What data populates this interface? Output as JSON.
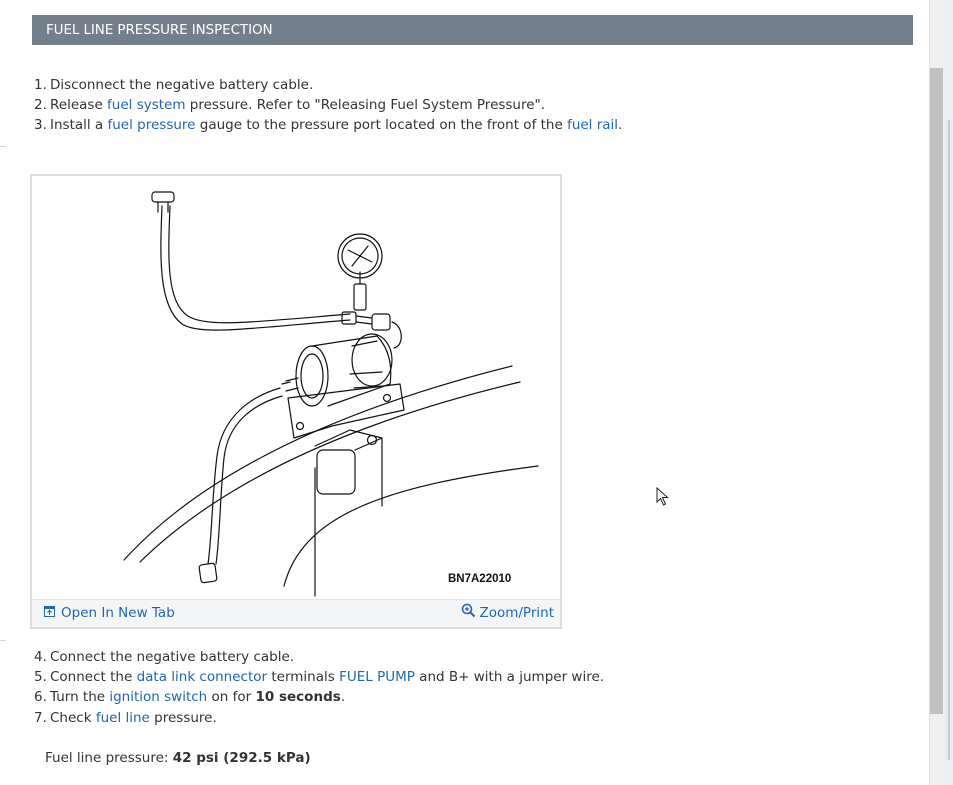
{
  "section_title": "FUEL LINE PRESSURE INSPECTION",
  "steps_a": [
    {
      "num": "1.",
      "parts": [
        {
          "t": "Disconnect the negative battery cable."
        }
      ]
    },
    {
      "num": "2.",
      "parts": [
        {
          "t": "Release "
        },
        {
          "t": "fuel system",
          "link": true
        },
        {
          "t": " pressure. Refer to \"Releasing Fuel System Pressure\"."
        }
      ]
    },
    {
      "num": "3.",
      "parts": [
        {
          "t": "Install a "
        },
        {
          "t": "fuel pressure",
          "link": true
        },
        {
          "t": " gauge to the pressure port located on the front of the "
        },
        {
          "t": "fuel rail",
          "link": true
        },
        {
          "t": "."
        }
      ]
    }
  ],
  "figure": {
    "code": "BN7A22010",
    "open_tab_label": "Open In New Tab",
    "zoom_label": "Zoom/Print"
  },
  "steps_b": [
    {
      "num": "4.",
      "parts": [
        {
          "t": "Connect the negative battery cable."
        }
      ]
    },
    {
      "num": "5.",
      "parts": [
        {
          "t": "Connect the "
        },
        {
          "t": "data link connector",
          "link": true
        },
        {
          "t": " terminals "
        },
        {
          "t": "FUEL PUMP",
          "link": true
        },
        {
          "t": " and B+ with a jumper wire."
        }
      ]
    },
    {
      "num": "6.",
      "parts": [
        {
          "t": "Turn the "
        },
        {
          "t": "ignition switch",
          "link": true
        },
        {
          "t": " on for "
        },
        {
          "t": "10 seconds",
          "bold": true
        },
        {
          "t": "."
        }
      ]
    },
    {
      "num": "7.",
      "parts": [
        {
          "t": "Check "
        },
        {
          "t": "fuel line",
          "link": true
        },
        {
          "t": " pressure."
        }
      ]
    }
  ],
  "result": {
    "label": "Fuel line pressure: ",
    "value": "42 psi (292.5 kPa)"
  }
}
